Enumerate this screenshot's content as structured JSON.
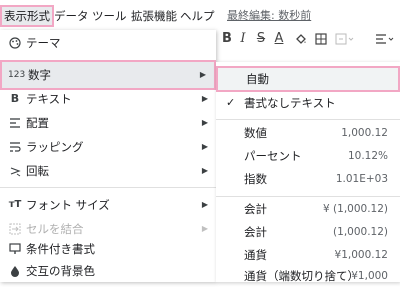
{
  "menubar": {
    "items": [
      "表示形式",
      "データ",
      "ツール",
      "拡張機能",
      "ヘルプ"
    ],
    "last_edit": "最終編集: 数秒前"
  },
  "toolbar": {
    "bold": "B",
    "italic": "I",
    "strikethrough": "S",
    "text_color": "A"
  },
  "format_menu": {
    "theme": "テーマ",
    "number": "数字",
    "text": "テキスト",
    "alignment": "配置",
    "wrapping": "ラッピング",
    "rotation": "回転",
    "font_size": "フォント サイズ",
    "merge_cells": "セルを結合",
    "conditional_formatting": "条件付き書式",
    "alternating_colors": "交互の背景色",
    "number_icon_text": "123"
  },
  "number_submenu": {
    "automatic": "自動",
    "plain_text": "書式なしテキスト",
    "formats": [
      {
        "name": "数値",
        "example": "1,000.12"
      },
      {
        "name": "パーセント",
        "example": "10.12%"
      },
      {
        "name": "指数",
        "example": "1.01E+03"
      }
    ],
    "currency_formats": [
      {
        "name": "会計",
        "example": "¥ (1,000.12)"
      },
      {
        "name": "会計",
        "example": "(1,000.12)"
      },
      {
        "name": "通貨",
        "example": "¥1,000.12"
      },
      {
        "name": "通貨（端数切り捨て）",
        "example": "¥1,000"
      }
    ]
  }
}
